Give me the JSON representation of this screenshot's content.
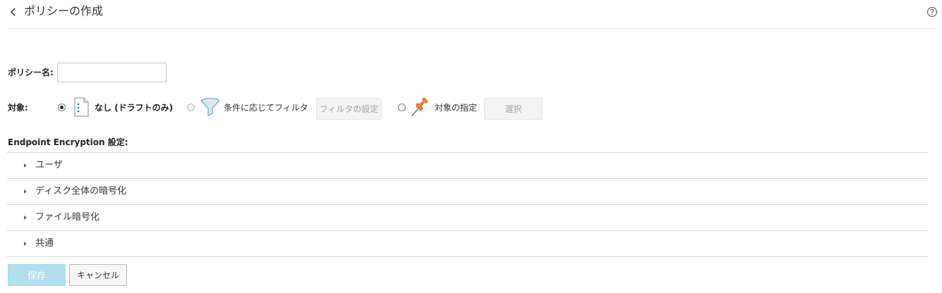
{
  "header": {
    "title": "ポリシーの作成"
  },
  "form": {
    "policy_name_label": "ポリシー名:",
    "policy_name_value": "",
    "target_label": "対象:",
    "options": [
      {
        "label": "なし (ドラフトのみ)",
        "selected": true,
        "disabled": false
      },
      {
        "label": "条件に応じてフィルタ",
        "selected": false,
        "disabled": true
      },
      {
        "label": "対象の指定",
        "selected": false,
        "disabled": false
      }
    ],
    "filter_button": "フィルタの設定",
    "select_button": "選択"
  },
  "settings": {
    "heading": "Endpoint Encryption 設定:",
    "sections": [
      {
        "label": "ユーザ"
      },
      {
        "label": "ディスク全体の暗号化"
      },
      {
        "label": "ファイル暗号化"
      },
      {
        "label": "共通"
      }
    ]
  },
  "footer": {
    "save_label": "保存",
    "cancel_label": "キャンセル"
  },
  "colors": {
    "save_button_bg": "#b3dff0",
    "funnel_icon": "#6fa3c2",
    "pin_icon": "#e8742a"
  }
}
